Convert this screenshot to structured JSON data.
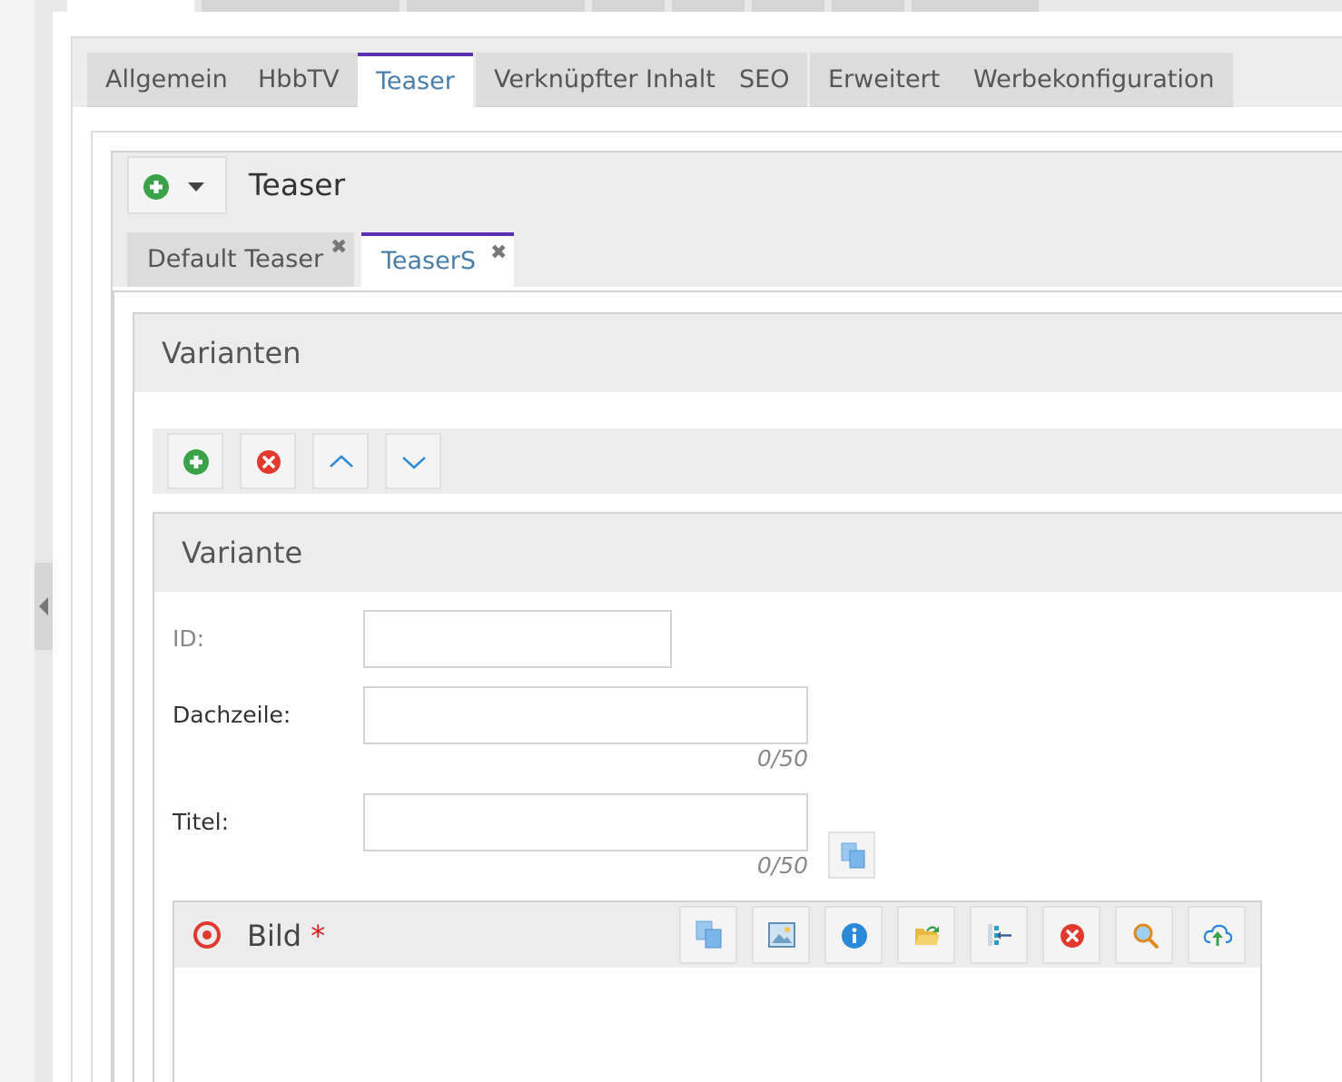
{
  "main_tabs": [
    {
      "label": "Allgemein",
      "active": false
    },
    {
      "label": "HbbTV",
      "active": false
    },
    {
      "label": "Teaser",
      "active": true
    },
    {
      "label": "Verknüpfter Inhalt",
      "active": false
    },
    {
      "label": "SEO",
      "active": false
    },
    {
      "label": "Erweitert",
      "active": false
    },
    {
      "label": "Werbekonfiguration",
      "active": false
    }
  ],
  "teaser": {
    "title": "Teaser",
    "tabs": [
      {
        "label": "Default Teaser",
        "close": "✖",
        "active": false
      },
      {
        "label": "TeaserS",
        "close": "✖",
        "active": true
      }
    ]
  },
  "variants": {
    "title": "Varianten",
    "toolbar_icons": [
      "add-icon",
      "remove-icon",
      "move-up-icon",
      "move-down-icon"
    ]
  },
  "variant": {
    "title": "Variante",
    "fields": {
      "id": {
        "label": "ID:",
        "value": ""
      },
      "dachzeile": {
        "label": "Dachzeile:",
        "value": "",
        "counter": "0/50"
      },
      "titel": {
        "label": "Titel:",
        "value": "",
        "counter": "0/50"
      }
    }
  },
  "bild": {
    "title": "Bild",
    "required_marker": "*",
    "toolbar_icons": [
      "copy-icon",
      "image-icon",
      "info-icon",
      "open-folder-icon",
      "tree-icon",
      "delete-icon",
      "search-icon",
      "upload-cloud-icon"
    ]
  },
  "colors": {
    "accent_tab": "#5c2fb1",
    "link_blue": "#4a7ea8",
    "green": "#3ca24a",
    "red": "#e03a2f",
    "info_blue": "#2a88d8"
  }
}
